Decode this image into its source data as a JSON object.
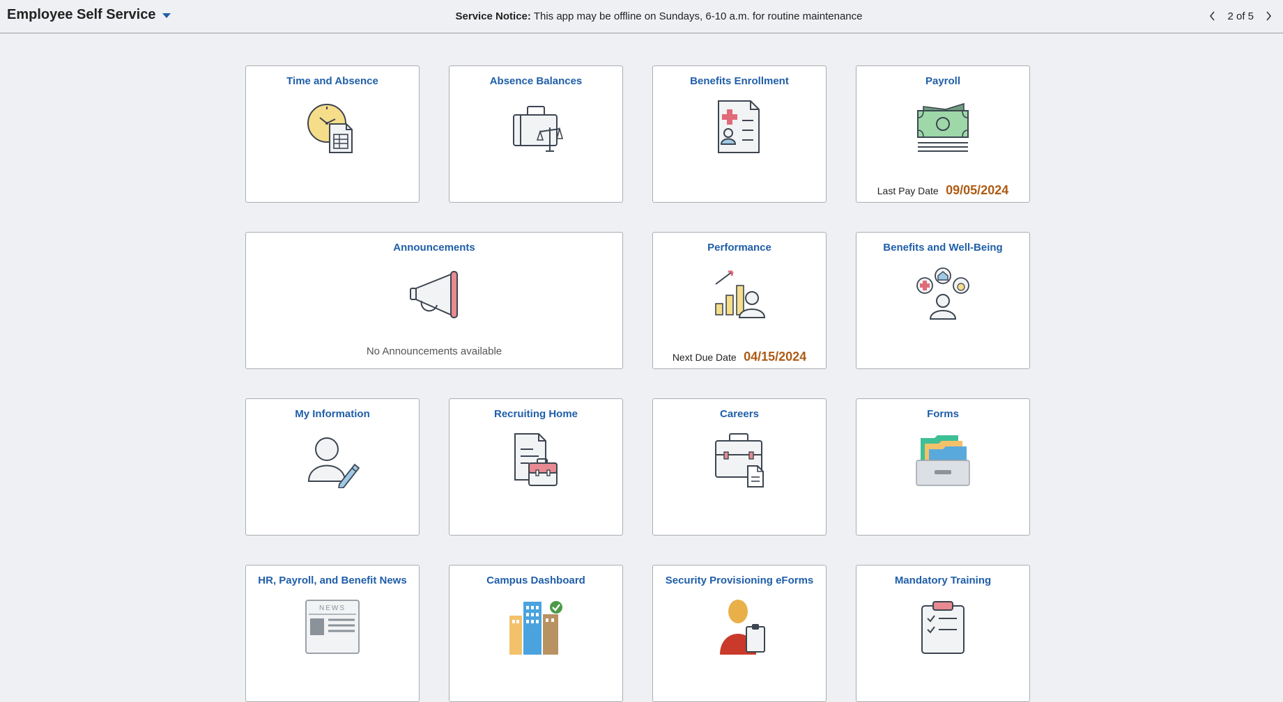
{
  "header": {
    "app_title": "Employee Self Service",
    "notice_label": "Service Notice:",
    "notice_text": "This app may be offline on Sundays, 6-10 a.m. for routine maintenance",
    "pager": "2 of 5"
  },
  "tiles": {
    "time_absence": {
      "title": "Time and Absence",
      "icon": "clock-timesheet-icon"
    },
    "absence_balances": {
      "title": "Absence Balances",
      "icon": "briefcase-scale-icon"
    },
    "benefits_enrollment": {
      "title": "Benefits Enrollment",
      "icon": "medical-form-icon"
    },
    "payroll": {
      "title": "Payroll",
      "icon": "money-icon",
      "footer_label": "Last Pay Date",
      "footer_value": "09/05/2024"
    },
    "announcements": {
      "title": "Announcements",
      "icon": "megaphone-icon",
      "message": "No Announcements available"
    },
    "performance": {
      "title": "Performance",
      "icon": "chart-person-icon",
      "footer_label": "Next Due Date",
      "footer_value": "04/15/2024"
    },
    "benefits_wellbeing": {
      "title": "Benefits and Well-Being",
      "icon": "person-benefits-icon"
    },
    "my_information": {
      "title": "My Information",
      "icon": "person-pencil-icon"
    },
    "recruiting_home": {
      "title": "Recruiting Home",
      "icon": "document-briefcase-icon"
    },
    "careers": {
      "title": "Careers",
      "icon": "briefcase-document-icon"
    },
    "forms": {
      "title": "Forms",
      "icon": "folder-tray-icon"
    },
    "hr_news": {
      "title": "HR, Payroll, and Benefit News",
      "icon": "newspaper-icon",
      "icon_text": "NEWS"
    },
    "campus_dashboard": {
      "title": "Campus Dashboard",
      "icon": "buildings-check-icon"
    },
    "security_eforms": {
      "title": "Security Provisioning eForms",
      "icon": "person-clipboard-icon"
    },
    "mandatory_training": {
      "title": "Mandatory Training",
      "icon": "checklist-clipboard-icon"
    }
  },
  "colors": {
    "title_blue": "#1f5ea8",
    "date_orange": "#ad5b13",
    "background": "#eff0f3"
  }
}
